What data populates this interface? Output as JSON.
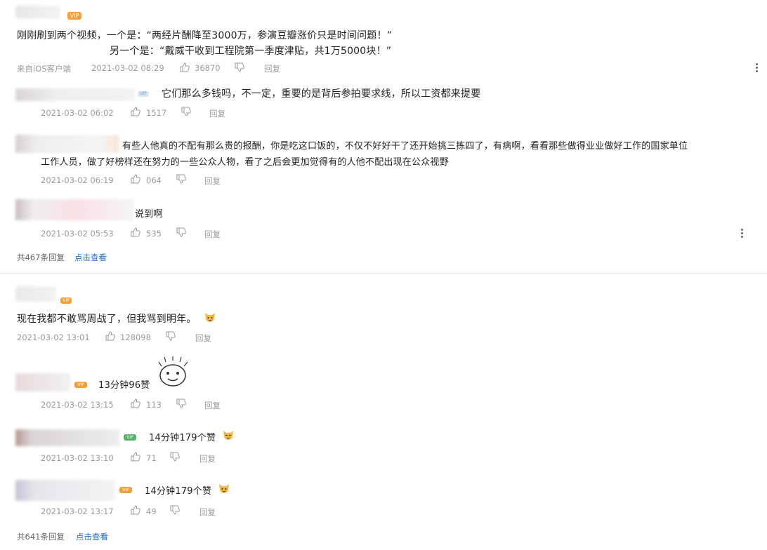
{
  "comments": [
    {
      "id": "c1",
      "badge": "VIP",
      "text_line1": "刚刚刷到两个视频，一个是：“两经片酬降至3000万，参演豆瓣涨价只是时间问题！”",
      "text_line2": "另一个是：“戴威干收到工程院第一季度津贴，共1万5000块！”",
      "source": "来自iOS客户端",
      "time": "2021-03-02 08:29",
      "likes": "36870",
      "reply_label": "回复"
    },
    {
      "id": "r1",
      "text": "它们那么多钱吗，不一定，重要的是背后参拍要求线，所以工资都来提要",
      "time": "2021-03-02 06:02",
      "likes": "1517",
      "reply_label": "回复"
    },
    {
      "id": "r2",
      "text_line1": "有些人他真的不配有那么贵的报酬，你是吃这口饭的，不仅不好好干了还开始挑三拣四了，有病啊，看看那些做得业业做好工作的国家单位",
      "text_line2": "工作人员，做了好榜样还在努力的一些公众人物，看了之后会更加觉得有的人他不配出现在公众视野",
      "time": "2021-03-02 06:19",
      "likes": "064",
      "reply_label": "回复"
    },
    {
      "id": "r3",
      "text": "说到啊",
      "time": "2021-03-02 05:53",
      "likes": "535",
      "reply_label": "回复"
    }
  ],
  "thread1_footer": {
    "count_text": "共467条回复",
    "expand_link": "点击查看"
  },
  "comments2": [
    {
      "id": "c2",
      "badge": "VIP",
      "text": "现在我都不敢骂周战了，但我骂到明年。",
      "time": "2021-03-02 13:01",
      "likes": "128098",
      "reply_label": "回复"
    },
    {
      "id": "r4",
      "badge": "VIP",
      "text": "13分钟96赞",
      "time": "2021-03-02 13:15",
      "likes": "113",
      "reply_label": "回复"
    },
    {
      "id": "r5",
      "badge": "VIP",
      "text": "14分钟179个赞",
      "time": "2021-03-02 13:10",
      "likes": "71",
      "reply_label": "回复"
    },
    {
      "id": "r6",
      "badge": "VIP",
      "text": "14分钟179个赞",
      "time": "2021-03-02 13:17",
      "likes": "49",
      "reply_label": "回复"
    }
  ],
  "thread2_footer": {
    "count_text": "共641条回复",
    "expand_link": "点击查看"
  },
  "colors": {
    "accent": "#1d6fd2",
    "meta": "#9b9b9b",
    "vip": "#f0a13a"
  }
}
